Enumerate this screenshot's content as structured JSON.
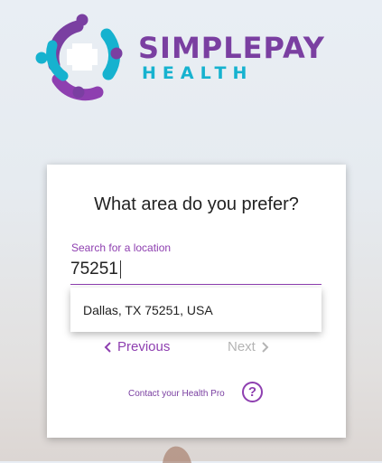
{
  "brand": {
    "name_line1": "SIMPLEPAY",
    "name_line2": "HEALTH",
    "logo_icon": "hands-circle-logo"
  },
  "colors": {
    "purple": "#8e3fb0",
    "brand_purple": "#7a3fa1",
    "teal": "#16b2cf",
    "disabled": "#b4b4b4"
  },
  "form": {
    "question": "What area do you prefer?",
    "search_label": "Search for a location",
    "search_value": "75251",
    "suggestions": [
      "Dallas, TX 75251, USA"
    ]
  },
  "nav": {
    "previous_label": "Previous",
    "previous_icon": "chevron-left-icon",
    "next_label": "Next",
    "next_icon": "chevron-right-icon"
  },
  "contact": {
    "label": "Contact your Health Pro",
    "icon": "help-icon",
    "icon_text": "?"
  }
}
